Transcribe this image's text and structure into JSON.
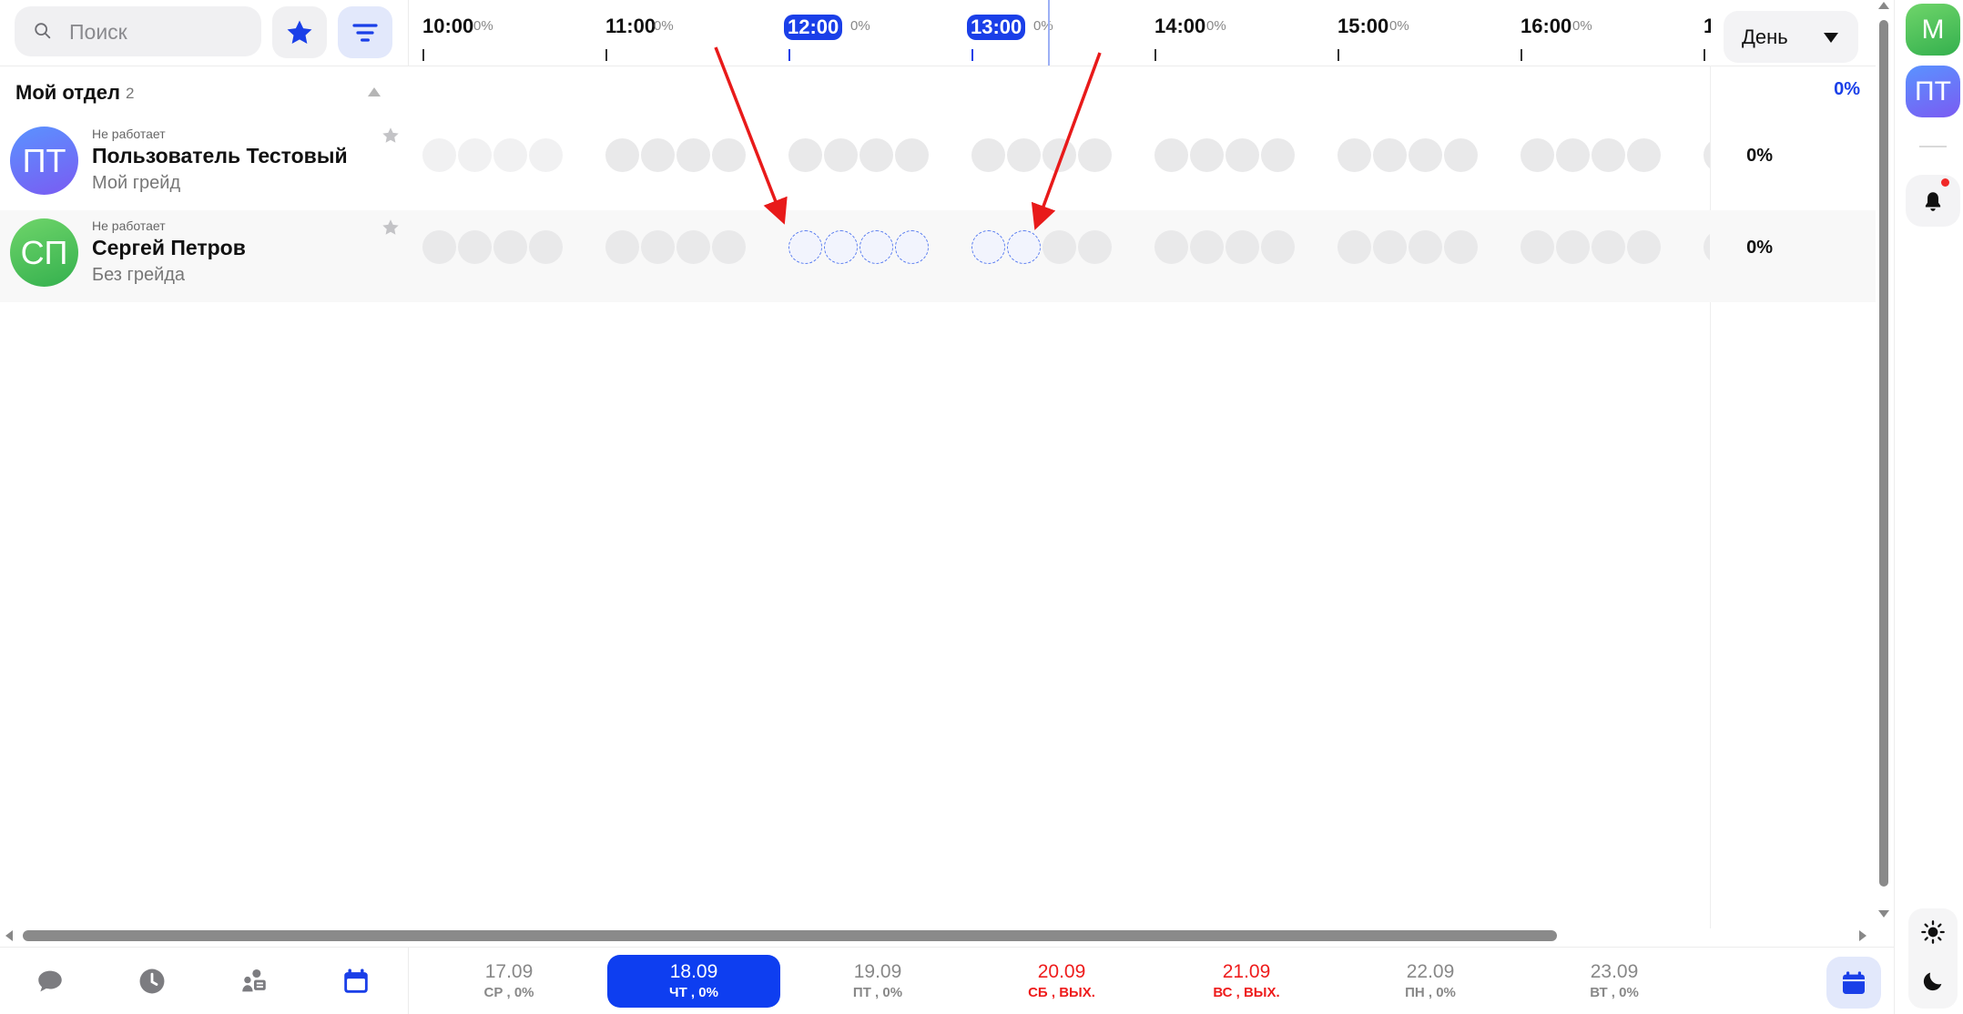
{
  "search": {
    "placeholder": "Поиск"
  },
  "timeline": {
    "hours": [
      {
        "time": "10:00",
        "pct": "0%",
        "current": false
      },
      {
        "time": "11:00",
        "pct": "0%",
        "current": false
      },
      {
        "time": "12:00",
        "pct": "0%",
        "current": true
      },
      {
        "time": "13:00",
        "pct": "0%",
        "current": true
      },
      {
        "time": "14:00",
        "pct": "0%",
        "current": false
      },
      {
        "time": "15:00",
        "pct": "0%",
        "current": false
      },
      {
        "time": "16:00",
        "pct": "0%",
        "current": false
      },
      {
        "time": "1",
        "pct": "",
        "current": false
      }
    ]
  },
  "view_select": {
    "label": "День"
  },
  "group": {
    "title": "Мой отдел",
    "count": "2",
    "pct": "0%"
  },
  "users": [
    {
      "initials": "ПТ",
      "status": "Не работает",
      "name": "Пользователь Тестовый",
      "grade": "Мой грейд",
      "pct": "0%",
      "color": "#6a79f7"
    },
    {
      "initials": "СП",
      "status": "Не работает",
      "name": "Сергей Петров",
      "grade": "Без грейда",
      "pct": "0%",
      "color": "#4fc25a"
    }
  ],
  "days": [
    {
      "date": "17.09",
      "sub": "СР , 0%",
      "weekend": false,
      "active": false
    },
    {
      "date": "18.09",
      "sub": "ЧТ , 0%",
      "weekend": false,
      "active": true
    },
    {
      "date": "19.09",
      "sub": "ПТ , 0%",
      "weekend": false,
      "active": false
    },
    {
      "date": "20.09",
      "sub": "СБ , ВЫХ.",
      "weekend": true,
      "active": false
    },
    {
      "date": "21.09",
      "sub": "ВС , ВЫХ.",
      "weekend": true,
      "active": false
    },
    {
      "date": "22.09",
      "sub": "ПН , 0%",
      "weekend": false,
      "active": false
    },
    {
      "date": "23.09",
      "sub": "ВТ , 0%",
      "weekend": false,
      "active": false
    }
  ],
  "right_bar": {
    "avatar_m": "М",
    "avatar_pt": "ПТ"
  },
  "colors": {
    "accent": "#1a3fe8",
    "weekend": "#ee1c1c",
    "arrow": "#e81a1a"
  },
  "icons": [
    "search-icon",
    "star-icon",
    "filter-icon",
    "chat-icon",
    "clock-icon",
    "team-icon",
    "calendar-icon",
    "bell-icon",
    "sun-icon",
    "moon-icon"
  ]
}
